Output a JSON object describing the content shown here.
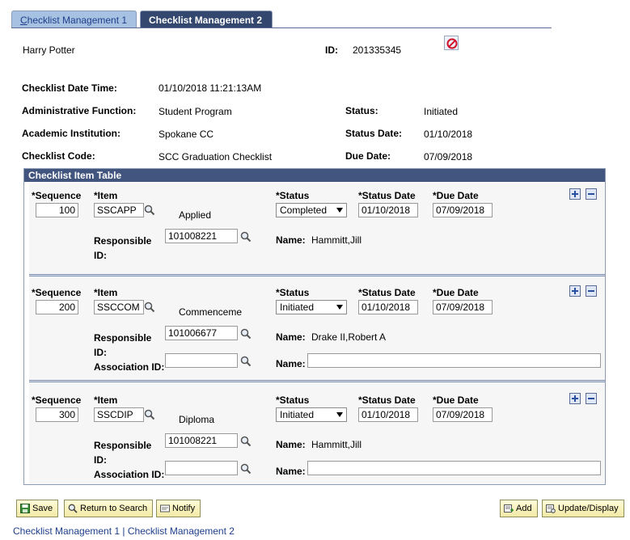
{
  "tabs": [
    {
      "label_first": "C",
      "label_rest": "hecklist Management 1"
    },
    {
      "label": "Checklist Management 2"
    }
  ],
  "header": {
    "name": "Harry Potter",
    "id_label": "ID:",
    "id_value": "201335345"
  },
  "fields": {
    "checklist_datetime_label": "Checklist Date Time:",
    "checklist_datetime_value": "01/10/2018 11:21:13AM",
    "admin_function_label": "Administrative Function:",
    "admin_function_value": "Student Program",
    "status_label": "Status:",
    "status_value": "Initiated",
    "academic_inst_label": "Academic Institution:",
    "academic_inst_value": "Spokane CC",
    "status_date_label": "Status Date:",
    "status_date_value": "01/10/2018",
    "checklist_code_label": "Checklist Code:",
    "checklist_code_value": "SCC Graduation Checklist",
    "due_date_label": "Due Date:",
    "due_date_value": "07/09/2018"
  },
  "table": {
    "title": "Checklist Item Table",
    "col_sequence": "*Sequence",
    "col_item": "*Item",
    "col_status": "*Status",
    "col_status_date": "*Status Date",
    "col_due_date": "*Due Date",
    "resp_label_1": "Responsible",
    "resp_label_2": "ID:",
    "assoc_label": "Association ID:",
    "name_label": "Name:",
    "rows": [
      {
        "sequence": "100",
        "item": "SSCAPP",
        "item_desc": "Applied",
        "status": "Completed",
        "status_date": "01/10/2018",
        "due_date": "07/09/2018",
        "responsible_id": "101008221",
        "resp_name": "Hammitt,Jill",
        "association_id": "",
        "assoc_name": ""
      },
      {
        "sequence": "200",
        "item": "SSCCOM",
        "item_desc": "Commenceme",
        "status": "Initiated",
        "status_date": "01/10/2018",
        "due_date": "07/09/2018",
        "responsible_id": "101006677",
        "resp_name": "Drake II,Robert A",
        "association_id": "",
        "assoc_name": ""
      },
      {
        "sequence": "300",
        "item": "SSCDIP",
        "item_desc": "Diploma",
        "status": "Initiated",
        "status_date": "01/10/2018",
        "due_date": "07/09/2018",
        "responsible_id": "101008221",
        "resp_name": "Hammitt,Jill",
        "association_id": "",
        "assoc_name": ""
      }
    ]
  },
  "buttons": {
    "save": "Save",
    "return_to_search": "Return to Search",
    "notify": "Notify",
    "add": "Add",
    "update_display": "Update/Display"
  },
  "footer": {
    "link1": "Checklist Management 1",
    "sep": " | ",
    "link2": "Checklist Management 2"
  },
  "icons": {
    "lookup": "magnifier-icon",
    "delete": "stop-icon",
    "add_row": "plus-icon",
    "delete_row": "minus-icon"
  }
}
